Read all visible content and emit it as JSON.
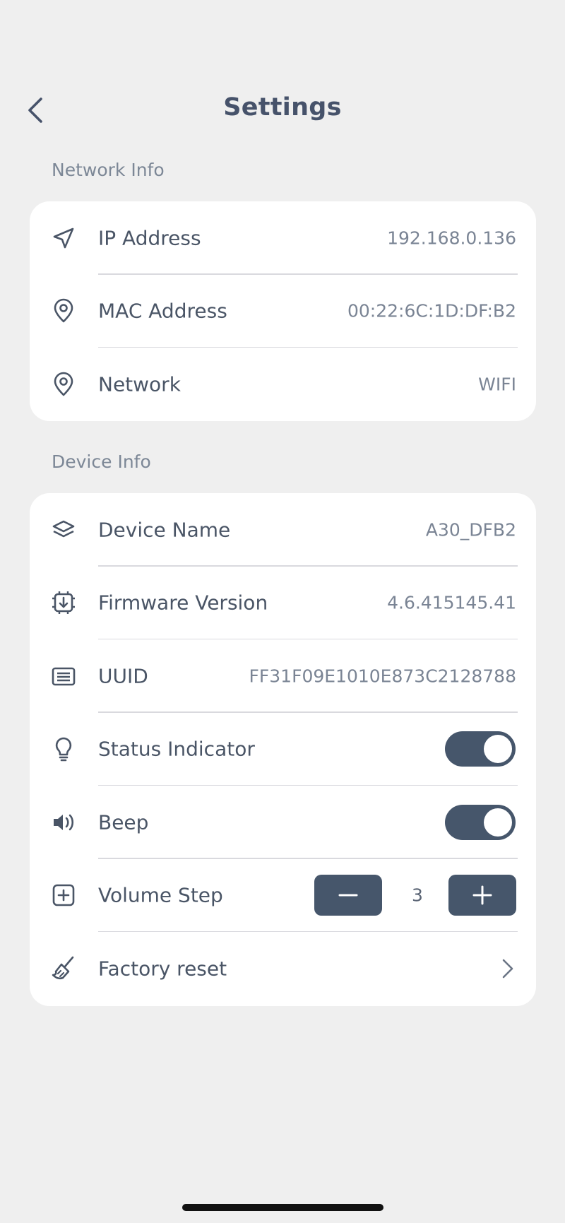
{
  "header": {
    "title": "Settings",
    "back_icon": "chevron-left-icon"
  },
  "network": {
    "section_label": "Network Info",
    "rows": [
      {
        "icon": "navigation-arrow-icon",
        "label": "IP Address",
        "value": "192.168.0.136"
      },
      {
        "icon": "location-pin-icon",
        "label": "MAC Address",
        "value": "00:22:6C:1D:DF:B2"
      },
      {
        "icon": "location-pin-icon",
        "label": "Network",
        "value": "WIFI"
      }
    ]
  },
  "device": {
    "section_label": "Device Info",
    "device_name": {
      "icon": "layers-icon",
      "label": "Device Name",
      "value": "A30_DFB2"
    },
    "firmware": {
      "icon": "chip-download-icon",
      "label": "Firmware Version",
      "value": "4.6.415145.41"
    },
    "uuid": {
      "icon": "list-card-icon",
      "label": "UUID",
      "value": "FF31F09E1010E873C2128788"
    },
    "status_indicator": {
      "icon": "lightbulb-icon",
      "label": "Status Indicator",
      "enabled": true
    },
    "beep": {
      "icon": "speaker-icon",
      "label": "Beep",
      "enabled": true
    },
    "volume_step": {
      "icon": "plus-square-icon",
      "label": "Volume Step",
      "value": "3"
    },
    "factory_reset": {
      "icon": "broom-icon",
      "label": "Factory reset"
    }
  },
  "colors": {
    "background": "#efefef",
    "card": "#ffffff",
    "accent": "#46566b",
    "text": "#4a5566",
    "muted": "#7a8494"
  }
}
